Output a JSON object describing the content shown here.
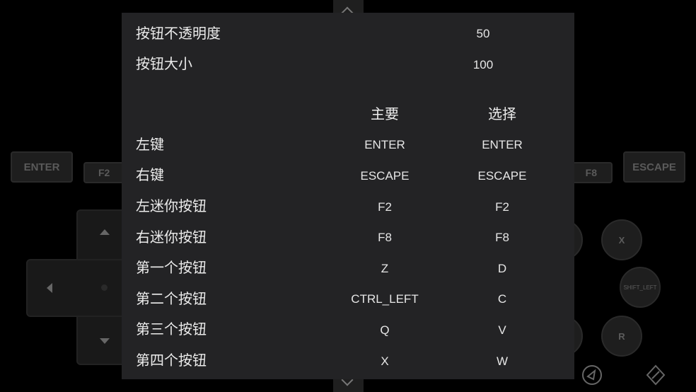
{
  "background": {
    "left_buttons": [
      "ENTER",
      "F2"
    ],
    "right_buttons": [
      "F8",
      "ESCAPE"
    ],
    "round_buttons": {
      "x": "X",
      "shift": "SHIFT_LEFT",
      "r": "R"
    }
  },
  "settings": {
    "opacity": {
      "label": "按钮不透明度",
      "value": "50"
    },
    "size": {
      "label": "按钮大小",
      "value": "100"
    }
  },
  "mapping": {
    "col_primary": "主要",
    "col_alt": "选择",
    "rows": [
      {
        "label": "左键",
        "primary": "ENTER",
        "alt": "ENTER"
      },
      {
        "label": "右键",
        "primary": "ESCAPE",
        "alt": "ESCAPE"
      },
      {
        "label": "左迷你按钮",
        "primary": "F2",
        "alt": "F2"
      },
      {
        "label": "右迷你按钮",
        "primary": "F8",
        "alt": "F8"
      },
      {
        "label": "第一个按钮",
        "primary": "Z",
        "alt": "D"
      },
      {
        "label": "第二个按钮",
        "primary": "CTRL_LEFT",
        "alt": "C"
      },
      {
        "label": "第三个按钮",
        "primary": "Q",
        "alt": "V"
      },
      {
        "label": "第四个按钮",
        "primary": "X",
        "alt": "W"
      }
    ]
  }
}
